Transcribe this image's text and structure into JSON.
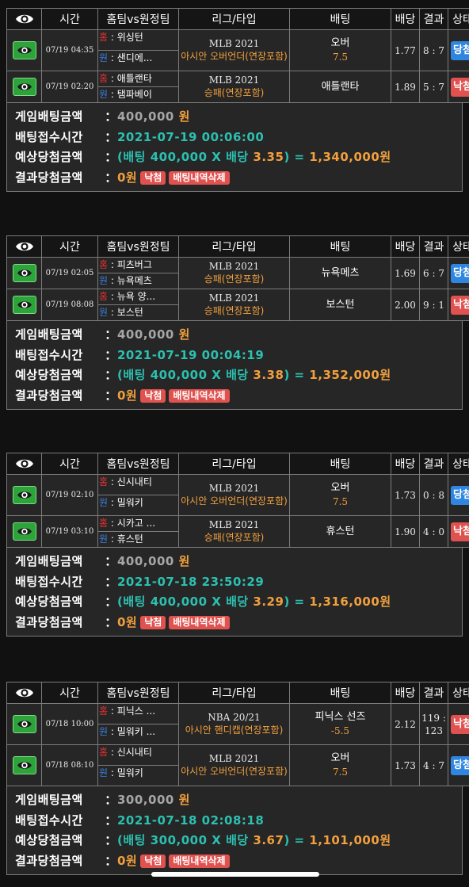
{
  "headers": {
    "time": "시간",
    "teams": "홈팀vs원정팀",
    "league": "리그/타입",
    "pick": "배팅",
    "odds": "배당",
    "score": "결과",
    "status": "상태"
  },
  "tags": {
    "home": "홈",
    "away": "원"
  },
  "summary_labels": {
    "bet_amount": "게임배팅금액",
    "bet_time": "배팅접수시간",
    "expected": "예상당첨금액",
    "result": "결과당첨금액",
    "colon": "：",
    "won": "원",
    "bet_word": "(배팅",
    "x": "X",
    "odds_word": "배당",
    "equals": "="
  },
  "slips": [
    {
      "games": [
        {
          "time": "07/19 04:35",
          "home": "위싱턴",
          "away": "샌디에...",
          "league": "MLB 2021",
          "type": "아시안 오버언더(연장포함)",
          "pick": "오버",
          "pick_line": "7.5",
          "odds": "1.77",
          "score": "8 : 7",
          "status": "당첨",
          "status_kind": "win"
        },
        {
          "time": "07/19 02:20",
          "home": "애틀랜타",
          "away": "탬파베이",
          "league": "MLB 2021",
          "type": "승패(연장포함)",
          "pick": "애틀랜타",
          "pick_line": "",
          "odds": "1.89",
          "score": "5 : 7",
          "status": "낙첨",
          "status_kind": "lose"
        }
      ],
      "summary": {
        "amount": "400,000",
        "time": "2021-07-19 00:06:00",
        "bet": "400,000",
        "odds": "3.35",
        "close": ")",
        "payout": "1,340,000",
        "result_amount": "0원",
        "result_status": "낙첨",
        "delete_label": "배팅내역삭제"
      }
    },
    {
      "games": [
        {
          "time": "07/19 02:05",
          "home": "피츠버그",
          "away": "뉴욕메츠",
          "league": "MLB 2021",
          "type": "승패(연장포함)",
          "pick": "뉴욕메츠",
          "pick_line": "",
          "odds": "1.69",
          "score": "6 : 7",
          "status": "당첨",
          "status_kind": "win"
        },
        {
          "time": "07/19 08:08",
          "home": "뉴욕 양...",
          "away": "보스턴",
          "league": "MLB 2021",
          "type": "승패(연장포함)",
          "pick": "보스턴",
          "pick_line": "",
          "odds": "2.00",
          "score": "9 : 1",
          "status": "낙첨",
          "status_kind": "lose"
        }
      ],
      "summary": {
        "amount": "400,000",
        "time": "2021-07-19 00:04:19",
        "bet": "400,000",
        "odds": "3.38",
        "close": ")",
        "payout": "1,352,000",
        "result_amount": "0원",
        "result_status": "낙첨",
        "delete_label": "배팅내역삭제"
      }
    },
    {
      "games": [
        {
          "time": "07/19 02:10",
          "home": "신시내티",
          "away": "밀워키",
          "league": "MLB 2021",
          "type": "아시안 오버언더(연장포함)",
          "pick": "오버",
          "pick_line": "7.5",
          "odds": "1.73",
          "score": "0 : 8",
          "status": "당첨",
          "status_kind": "win"
        },
        {
          "time": "07/19 03:10",
          "home": "시카고 ...",
          "away": "휴스턴",
          "league": "MLB 2021",
          "type": "승패(연장포함)",
          "pick": "휴스턴",
          "pick_line": "",
          "odds": "1.90",
          "score": "4 : 0",
          "status": "낙첨",
          "status_kind": "lose"
        }
      ],
      "summary": {
        "amount": "400,000",
        "time": "2021-07-18 23:50:29",
        "bet": "400,000",
        "odds": "3.29",
        "close": ")",
        "payout": "1,316,000",
        "result_amount": "0원",
        "result_status": "낙첨",
        "delete_label": "배팅내역삭제"
      }
    },
    {
      "games": [
        {
          "time": "07/18 10:00",
          "home": "피닉스 ...",
          "away": "밀워키 ...",
          "league": "NBA 20/21",
          "type": "아시안 핸디캡(연장포함)",
          "pick": "피닉스 선즈",
          "pick_line": "-5.5",
          "odds": "2.12",
          "score": "119 : 123",
          "status": "낙첨",
          "status_kind": "lose"
        },
        {
          "time": "07/18 08:10",
          "home": "신시내티",
          "away": "밀워키",
          "league": "MLB 2021",
          "type": "아시안 오버언더(연장포함)",
          "pick": "오버",
          "pick_line": "7.5",
          "odds": "1.73",
          "score": "4 : 7",
          "status": "당첨",
          "status_kind": "win"
        }
      ],
      "summary": {
        "amount": "300,000",
        "time": "2021-07-18 02:08:18",
        "bet": "300,000",
        "odds": "3.67",
        "close": ")",
        "payout": "1,101,000",
        "result_amount": "0원",
        "result_status": "낙첨",
        "delete_label": "배팅내역삭제"
      }
    }
  ],
  "colors": {
    "win": "#2f86e0",
    "lose": "#e0524f",
    "teal": "#2cc0b0",
    "orange": "#f2a03d",
    "eye_button": "#2ca43a"
  },
  "icons": {
    "header": "eye-icon",
    "row": "eye-icon"
  }
}
